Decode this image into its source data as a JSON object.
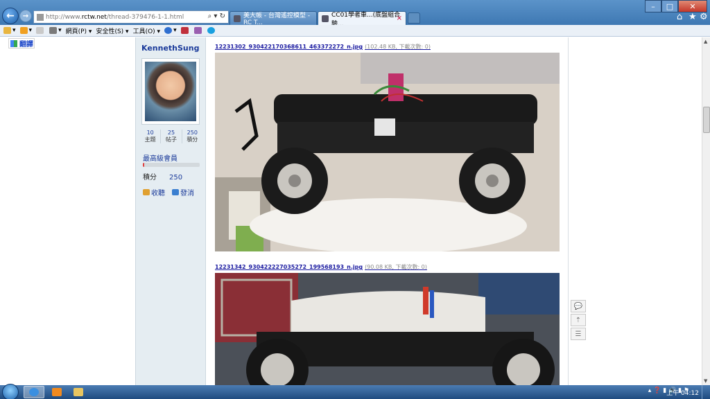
{
  "browser": {
    "address_url_prefix": "http://www.",
    "address_url_domain": "rctw.net",
    "address_url_path": "/thread-379476-1-1.html",
    "address_controls": "⌕ ▾ ↻",
    "tabs": [
      {
        "label": "美大帳 - 台灣遙控模型 - RC T..."
      },
      {
        "label": "CC01學者車...(底盤組合驗..."
      }
    ],
    "tab_close": "×",
    "window_controls": {
      "minimize": "–",
      "maximize": "□",
      "close": "✕"
    },
    "right_tools": {
      "home": "⌂",
      "favorites": "★",
      "settings": "⚙"
    }
  },
  "command_bar": {
    "items": [
      {
        "label": "▾"
      },
      {
        "label": "▾"
      },
      {
        "label": "▾"
      },
      {
        "label": "網頁(P) ▾"
      },
      {
        "label": "安全性(S) ▾"
      },
      {
        "label": "工具(O) ▾"
      },
      {
        "label": "▾"
      }
    ]
  },
  "translate_label": "翻譯",
  "user": {
    "name": "KennethSung",
    "stats": [
      {
        "value": "10",
        "label": "主題"
      },
      {
        "value": "25",
        "label": "帖子"
      },
      {
        "value": "250",
        "label": "積分"
      }
    ],
    "rank": "最高級會員",
    "rank_progress": 0.02,
    "points_label": "積分",
    "points_value": "250",
    "actions": [
      {
        "label": "收聽",
        "color": "#e0a030"
      },
      {
        "label": "發消",
        "color": "#3a7fd0"
      }
    ]
  },
  "attachments": [
    {
      "filename": "12231302_930422170368611_463372272_n.jpg",
      "meta": "(102.48 KB, 下載次數: 0)"
    },
    {
      "filename": "12231342_930422227035272_199568193_n.jpg",
      "meta": "(90.08 KB, 下載次數: 0)"
    }
  ],
  "float_tools": [
    {
      "icon": "💬"
    },
    {
      "icon": "⇡"
    },
    {
      "icon": "☰"
    }
  ],
  "scrollbar": {
    "up": "▲",
    "down": "▼"
  },
  "taskbar": {
    "tray_icons": "▴ ❓ ▮ 🔊 ▮ ⚑",
    "clock": "上午 04:12"
  },
  "colors": {
    "title_blue": "#3e78b3",
    "sidebar_bg": "#e5edf2",
    "link_blue": "#1a3a9a",
    "taskbar": "#1f4b7f"
  }
}
